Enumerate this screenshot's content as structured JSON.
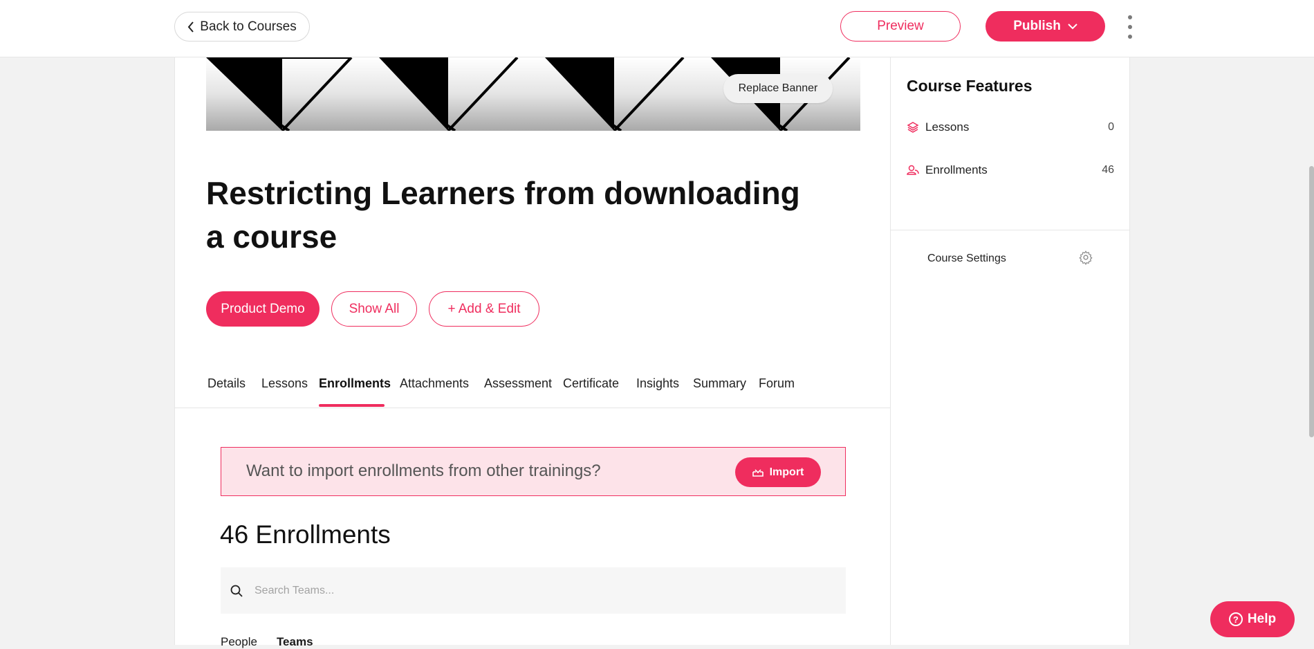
{
  "header": {
    "back_label": "Back to Courses",
    "preview_label": "Preview",
    "publish_label": "Publish"
  },
  "banner": {
    "replace_label": "Replace Banner"
  },
  "course": {
    "title": "Restricting Learners from downloading a course",
    "tags": {
      "primary": "Product Demo",
      "show_all": "Show All",
      "add_edit": "+ Add & Edit"
    }
  },
  "tabs": [
    {
      "label": "Details"
    },
    {
      "label": "Lessons"
    },
    {
      "label": "Enrollments"
    },
    {
      "label": "Attachments"
    },
    {
      "label": "Assessment"
    },
    {
      "label": "Certificate"
    },
    {
      "label": "Insights"
    },
    {
      "label": "Summary"
    },
    {
      "label": "Forum"
    }
  ],
  "active_tab": "Enrollments",
  "enrollments": {
    "import_prompt": "Want to import enrollments from other trainings?",
    "import_label": "Import",
    "heading": "46 Enrollments",
    "search_placeholder": "Search Teams...",
    "subtabs": {
      "people": "People",
      "teams": "Teams"
    },
    "active_subtab": "Teams"
  },
  "sidebar": {
    "title": "Course Features",
    "features": [
      {
        "label": "Lessons",
        "count": "0",
        "icon": "layers-icon"
      },
      {
        "label": "Enrollments",
        "count": "46",
        "icon": "users-icon"
      }
    ],
    "settings_label": "Course Settings"
  },
  "help": {
    "label": "Help"
  },
  "colors": {
    "accent": "#ef2d5e",
    "accent_light": "#fde3e9",
    "background": "#f2f2f2"
  }
}
